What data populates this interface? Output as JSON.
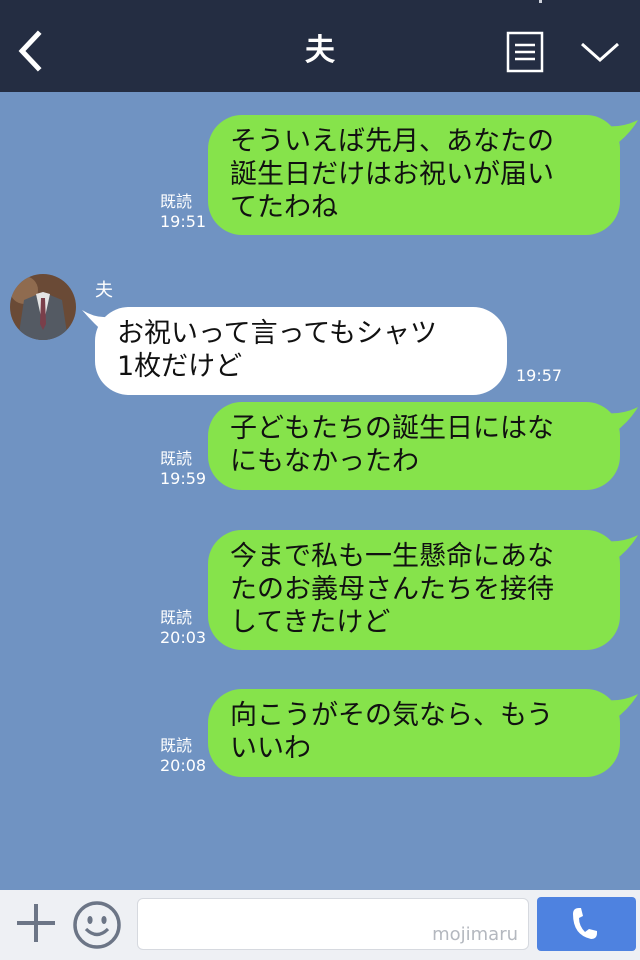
{
  "header": {
    "title": "夫"
  },
  "sender": {
    "name": "夫"
  },
  "messages": [
    {
      "direction": "out",
      "text": "そういえば先月、あなたの\n誕生日だけはお祝いが届い\nてたわね",
      "read": "既読",
      "time": "19:51"
    },
    {
      "direction": "in",
      "text": "お祝いって言ってもシャツ\n1枚だけど",
      "time": "19:57"
    },
    {
      "direction": "out",
      "text": "子どもたちの誕生日にはな\nにもなかったわ",
      "read": "既読",
      "time": "19:59"
    },
    {
      "direction": "out",
      "text": "今まで私も一生懸命にあな\nたのお義母さんたちを接待\nしてきたけど",
      "read": "既読",
      "time": "20:03"
    },
    {
      "direction": "out",
      "text": "向こうがその気なら、もう\nいいわ",
      "read": "既読",
      "time": "20:08"
    }
  ],
  "footer": {
    "input_value": "",
    "watermark": "mojimaru"
  },
  "icons": {
    "back": "chevron-left-icon",
    "menu": "list-icon",
    "collapse": "chevron-down-icon",
    "add": "plus-icon",
    "emoji": "smile-icon",
    "call": "phone-icon"
  },
  "colors": {
    "header_bg": "#242d42",
    "chat_bg": "#7093c2",
    "outgoing_bubble": "#86e34b",
    "incoming_bubble": "#ffffff",
    "call_button": "#4e82e0"
  }
}
